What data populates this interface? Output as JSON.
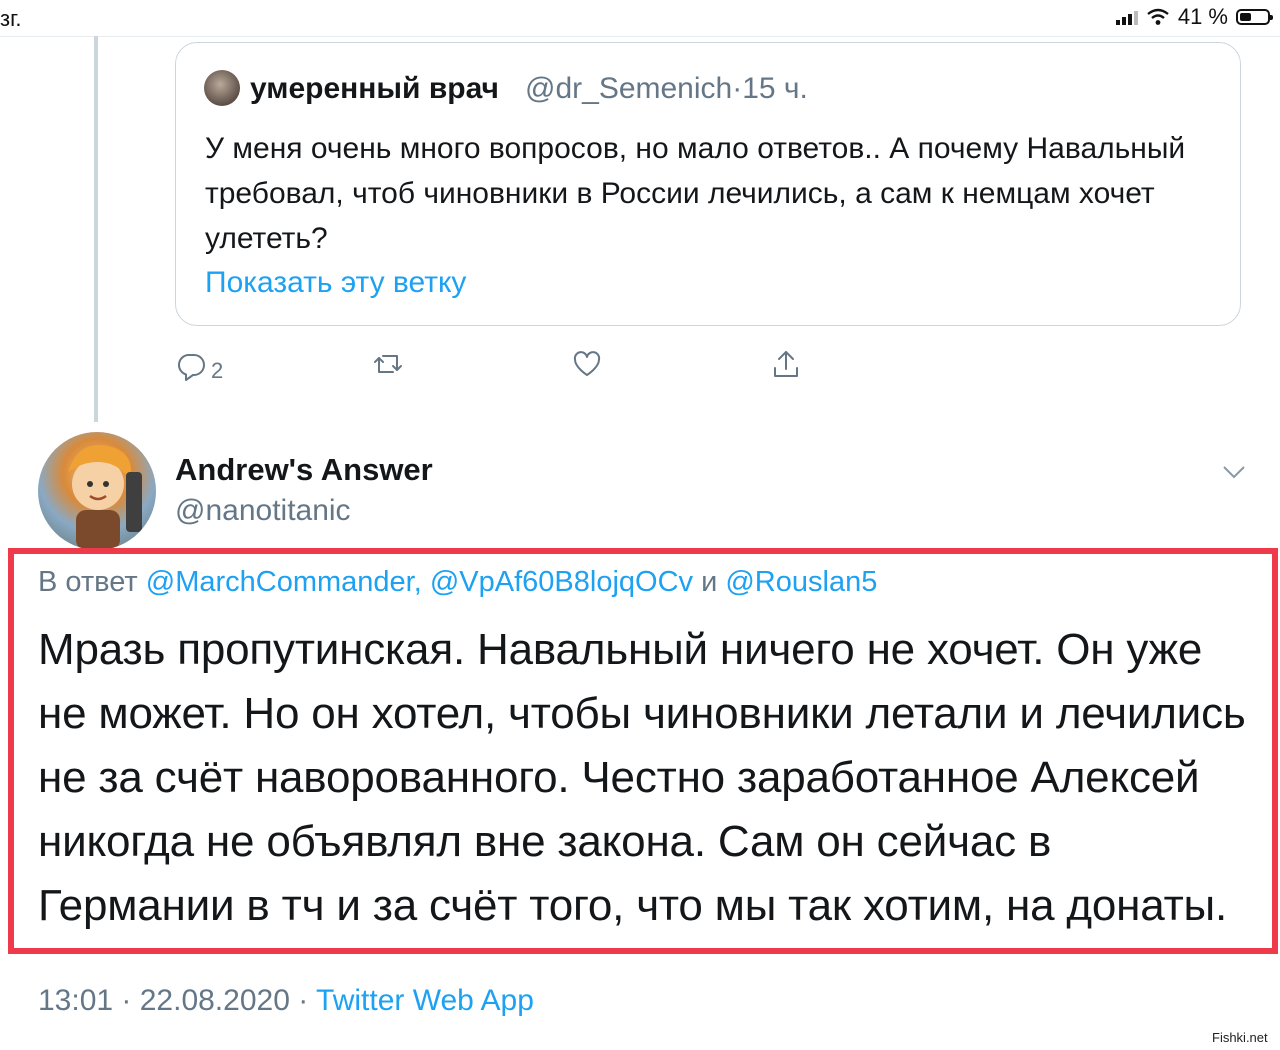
{
  "status_bar": {
    "left_text": "зг.",
    "battery": "41 %",
    "battery_level": 0.41
  },
  "quoted_tweet": {
    "name": "умеренный врач",
    "handle": "@dr_Semenich",
    "separator": "·",
    "time": "15 ч.",
    "text": "У меня очень много вопросов, но мало ответов.. А почему Навальный требовал, чтоб чиновники в России лечились, а сам к немцам хочет улететь?",
    "show_thread": "Показать эту ветку"
  },
  "actions": {
    "reply_count": "2",
    "icons": [
      "reply-icon",
      "retweet-icon",
      "like-icon",
      "share-icon"
    ]
  },
  "main_tweet": {
    "name": "Andrew's Answer",
    "handle": "@nanotitanic",
    "reply_prefix": "В ответ",
    "mentions": "@MarchCommander, @VpAf60B8lojqOCv",
    "and": "и",
    "last_mention": "@Rouslan5",
    "text": "Мразь пропутинская. Навальный ничего не хочет. Он уже не может. Но он хотел, чтобы чиновники летали и лечились не за счёт наворованного. Честно заработанное Алексей никогда не объявлял вне закона. Сам он сейчас в Германии в тч и за счёт того, что  мы так хотим, на донаты.",
    "time": "13:01 · 22.08.2020",
    "dot": "·",
    "app": "Twitter Web App"
  },
  "colors": {
    "accent": "#1da1f2",
    "highlight": "#ef3a4c",
    "muted": "#657786"
  },
  "watermark": "Fishki.net"
}
